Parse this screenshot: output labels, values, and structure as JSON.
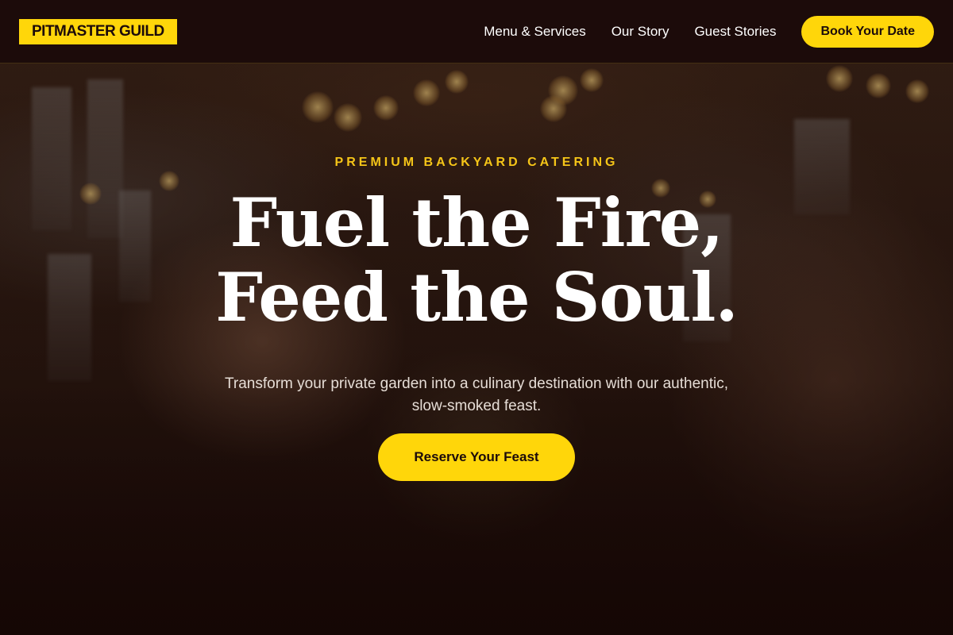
{
  "nav": {
    "logo": "PITMASTER GUILD",
    "links": [
      "Menu & Services",
      "Our Story",
      "Guest Stories"
    ],
    "cta": "Book Your Date"
  },
  "hero": {
    "eyebrow": "PREMIUM BACKYARD CATERING",
    "headline_line1": "Fuel the Fire,",
    "headline_line2": "Feed the Soul.",
    "subhead": "Transform your private garden into a culinary destination with our authentic, slow-smoked feast.",
    "cta": "Reserve Your Feast"
  },
  "colors": {
    "accent": "#ffd60a",
    "nav_bg": "#1c0b0a",
    "eyebrow": "#f5c518",
    "text": "#ffffff"
  }
}
